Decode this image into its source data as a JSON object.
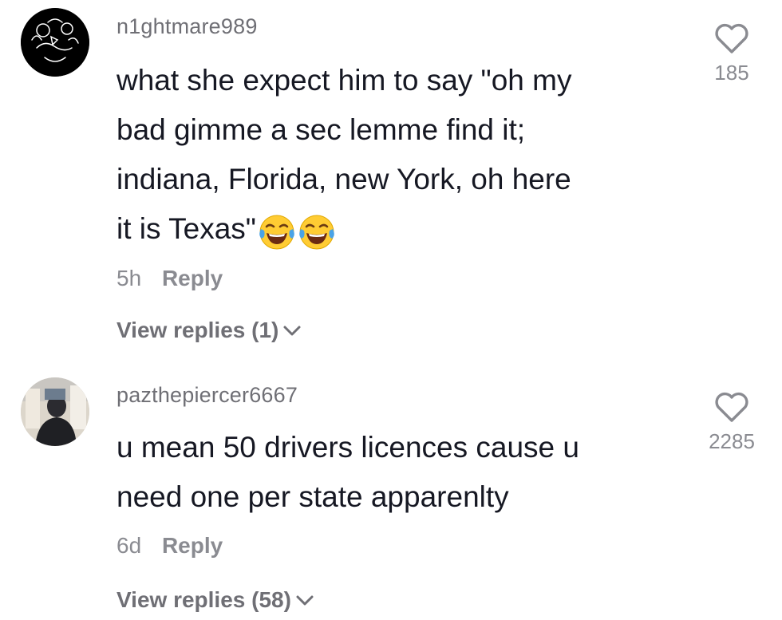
{
  "comments": [
    {
      "username": "n1ghtmare989",
      "text_lines": [
        "what she expect him to say \"oh my",
        "bad gimme a sec lemme find it;",
        "indiana, Florida, new York, oh here",
        "it is Texas\""
      ],
      "emoji": "face-with-tears-of-joy-icon",
      "time": "5h",
      "reply_label": "Reply",
      "view_replies": "View replies (1)",
      "likes": "185"
    },
    {
      "username": "pazthepiercer6667",
      "text_lines": [
        "u mean 50 drivers licences cause u",
        "need one per state apparenlty"
      ],
      "time": "6d",
      "reply_label": "Reply",
      "view_replies": "View replies (58)",
      "likes": "2285"
    }
  ]
}
